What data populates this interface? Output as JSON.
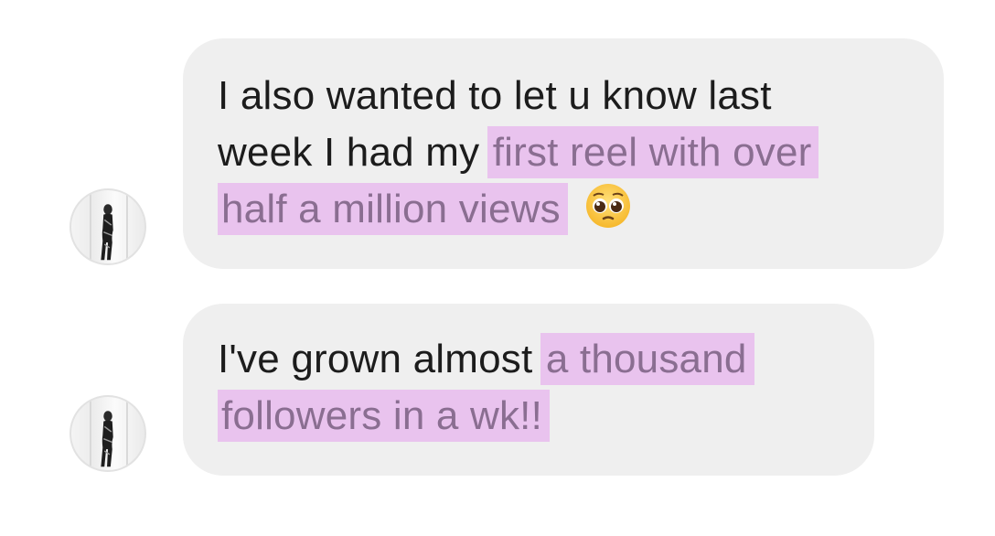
{
  "messages": [
    {
      "avatar_icon": "profile-avatar-icon",
      "line1": "I also wanted to let u know last",
      "line2_plain": "week I had my ",
      "line2_highlight": "first reel with over",
      "line3_highlight": "half a million views",
      "emoji": "pleading-face-emoji"
    },
    {
      "avatar_icon": "profile-avatar-icon",
      "line1_plain": "I've grown almost ",
      "line1_highlight": "a thousand",
      "line2_highlight": "followers in a wk!!"
    }
  ],
  "colors": {
    "bubble_bg": "#efefef",
    "highlight_bg": "#e9c3ee",
    "highlight_text": "#8a6e91",
    "text": "#1c1c1c"
  }
}
